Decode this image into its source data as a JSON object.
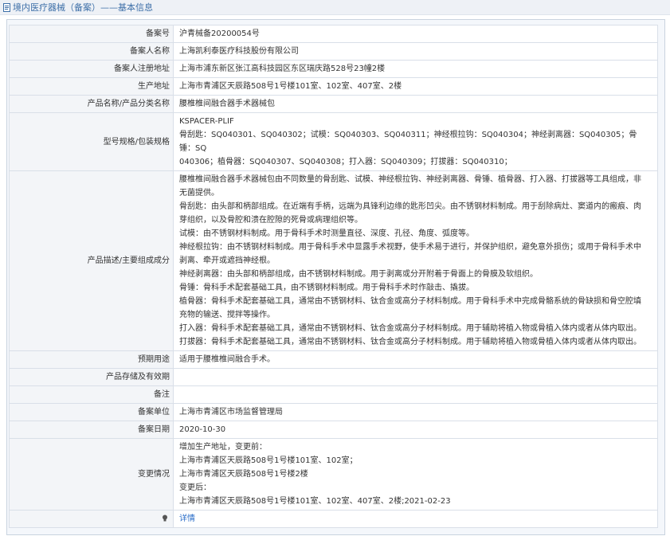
{
  "header": {
    "title": "境内医疗器械（备案）——基本信息",
    "icon": "document-icon"
  },
  "rows": [
    {
      "label": "备案号",
      "lines": [
        "沪青械备20200054号"
      ]
    },
    {
      "label": "备案人名称",
      "lines": [
        "上海凯利泰医疗科技股份有限公司"
      ]
    },
    {
      "label": "备案人注册地址",
      "lines": [
        "上海市浦东新区张江高科技园区东区瑞庆路528号23幢2楼"
      ]
    },
    {
      "label": "生产地址",
      "lines": [
        "上海市青浦区天辰路508号1号楼101室、102室、407室、2楼"
      ]
    },
    {
      "label": "产品名称/产品分类名称",
      "lines": [
        "腰椎椎间融合器手术器械包"
      ]
    },
    {
      "label": "型号规格/包装规格",
      "lines": [
        "KSPACER-PLIF",
        "骨刮匙：SQ040301、SQ040302；试模：SQ040303、SQ040311；神经根拉钩：SQ040304；神经剥离器：SQ040305；骨锤：SQ",
        "040306；植骨器：SQ040307、SQ040308；打入器：SQ040309；打拔器：SQ040310；"
      ]
    },
    {
      "label": "产品描述/主要组成成分",
      "lines": [
        "腰椎椎间融合器手术器械包由不同数量的骨刮匙、试模、神经根拉钩、神经剥离器、骨锤、植骨器、打入器、打拔器等工具组成，非",
        "无菌提供。",
        "骨刮匙：由头部和柄部组成。在近端有手柄，远端为具锋利边缘的匙形凹尖。由不锈钢材料制成。用于刮除病灶、窦道内的瘢痕、肉",
        "芽组织，以及骨腔和溃在腔隙的死骨或病理组织等。",
        "试模：由不锈钢材料制成。用于骨科手术时测量直径、深度、孔径、角度、弧度等。",
        "神经根拉钩：由不锈钢材料制成。用于骨科手术中显露手术视野，使手术易于进行，并保护组织，避免意外损伤；或用于骨科手术中",
        "剥离、牵开或遮挡神经根。",
        "神经剥离器：由头部和柄部组成，由不锈钢材料制成。用于剥离或分开附着于骨面上的骨膜及软组织。",
        "骨锤：骨科手术配套基础工具，由不锈钢材料制成。用于骨科手术时作敲击、撬拔。",
        "植骨器：骨科手术配套基础工具，通常由不锈钢材料、钛合金或高分子材料制成。用于骨科手术中完成骨骼系统的骨缺损和骨空腔填",
        "充物的输送、搅拌等操作。",
        "打入器：骨科手术配套基础工具，通常由不锈钢材料、钛合金或高分子材料制成。用于辅助将植入物或骨植入体内或者从体内取出。",
        "打拔器：骨科手术配套基础工具，通常由不锈钢材料、钛合金或高分子材料制成。用于辅助将植入物或骨植入体内或者从体内取出。"
      ]
    },
    {
      "label": "预期用途",
      "lines": [
        "适用于腰椎椎间融合手术。"
      ]
    },
    {
      "label": "产品存储及有效期",
      "lines": []
    },
    {
      "label": "备注",
      "lines": []
    },
    {
      "label": "备案单位",
      "lines": [
        "上海市青浦区市场监督管理局"
      ]
    },
    {
      "label": "备案日期",
      "lines": [
        "2020-10-30"
      ]
    },
    {
      "label": "变更情况",
      "lines": [
        "增加生产地址，变更前：",
        "上海市青浦区天辰路508号1号楼101室、102室；",
        "上海市青浦区天辰路508号1号楼2楼",
        "变更后：",
        "上海市青浦区天辰路508号1号楼101室、102室、407室、2楼;2021-02-23"
      ]
    }
  ],
  "footer_row": {
    "label": "",
    "label_icon": "lightbulb-icon",
    "link": "详情"
  }
}
